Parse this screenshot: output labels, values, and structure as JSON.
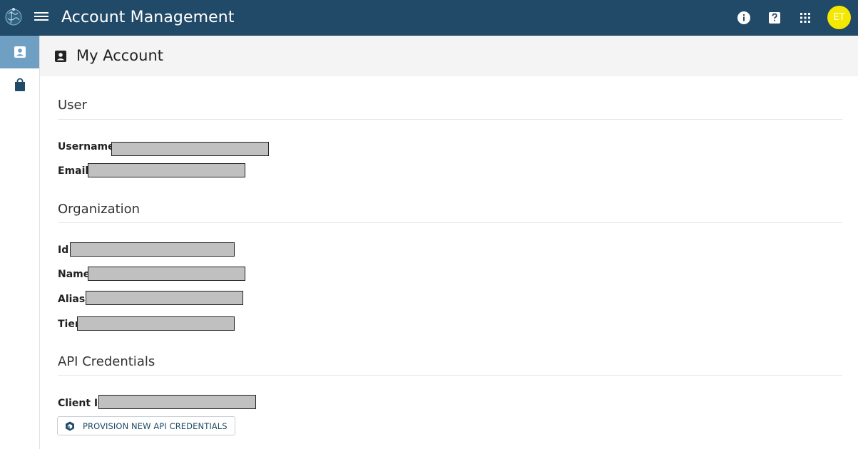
{
  "app": {
    "title": "Account Management"
  },
  "topbar": {
    "icons": [
      "globe-logo-icon",
      "menu-icon",
      "info-icon",
      "help-icon",
      "apps-grid-icon"
    ],
    "avatar_initials": "ET",
    "avatar_color": "#f4e800",
    "bar_color": "#214a68"
  },
  "sidebar": {
    "items": [
      {
        "name": "account-card-icon",
        "active": true
      },
      {
        "name": "shopping-bag-icon",
        "active": false
      }
    ],
    "active_color": "#6f9fc2"
  },
  "page": {
    "title": "My Account"
  },
  "sections": {
    "user": {
      "title": "User",
      "fields": {
        "username": "Username",
        "email": "Email"
      }
    },
    "organization": {
      "title": "Organization",
      "fields": {
        "id": "Id",
        "name": "Name",
        "alias": "Alias",
        "tier": "Tier"
      }
    },
    "api": {
      "title": "API Credentials",
      "fields": {
        "client_id": "Client Id"
      },
      "button_label": "PROVISION NEW API CREDENTIALS"
    }
  }
}
